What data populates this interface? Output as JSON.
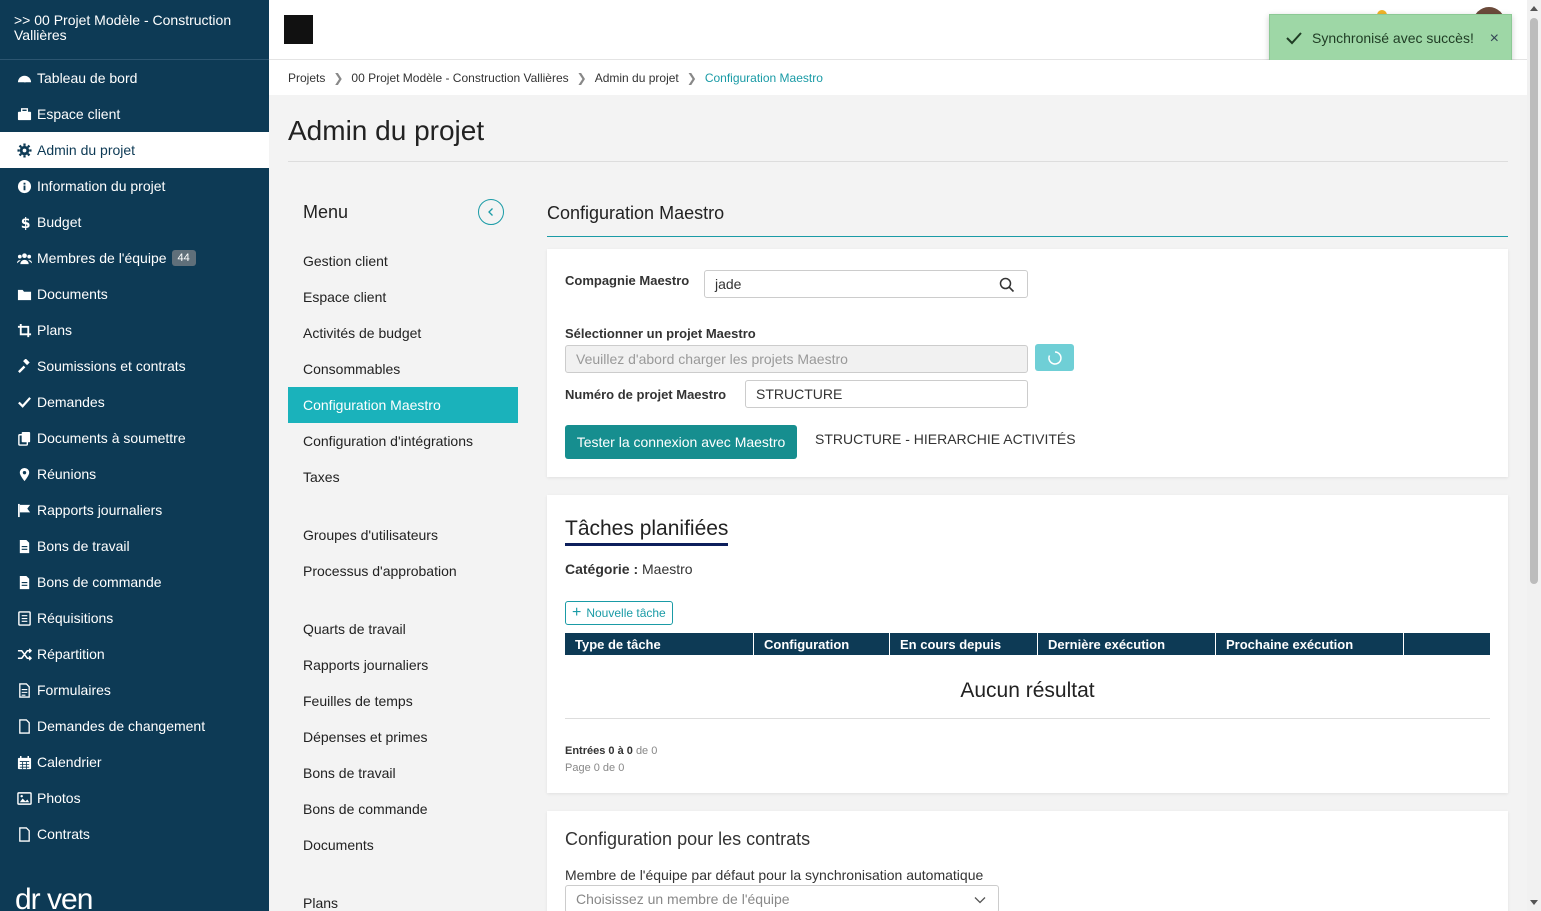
{
  "sidebar": {
    "project": ">> 00 Projet Modèle - Construction Vallières",
    "items": [
      {
        "label": "Tableau de bord",
        "icon": "dashboard-icon"
      },
      {
        "label": "Espace client",
        "icon": "briefcase-icon"
      },
      {
        "label": "Admin du projet",
        "icon": "gear-icon",
        "active": true
      },
      {
        "label": "Information du projet",
        "icon": "info-icon"
      },
      {
        "label": "Budget",
        "icon": "dollar-icon"
      },
      {
        "label": "Membres de l'équipe",
        "icon": "users-icon",
        "badge": "44"
      },
      {
        "label": "Documents",
        "icon": "folder-icon"
      },
      {
        "label": "Plans",
        "icon": "crop-icon"
      },
      {
        "label": "Soumissions et contrats",
        "icon": "gavel-icon"
      },
      {
        "label": "Demandes",
        "icon": "check-icon"
      },
      {
        "label": "Documents à soumettre",
        "icon": "copy-icon"
      },
      {
        "label": "Réunions",
        "icon": "map-pin-icon"
      },
      {
        "label": "Rapports journaliers",
        "icon": "flag-icon"
      },
      {
        "label": "Bons de travail",
        "icon": "file-icon"
      },
      {
        "label": "Bons de commande",
        "icon": "file-icon"
      },
      {
        "label": "Réquisitions",
        "icon": "list-icon"
      },
      {
        "label": "Répartition",
        "icon": "shuffle-icon"
      },
      {
        "label": "Formulaires",
        "icon": "form-icon"
      },
      {
        "label": "Demandes de changement",
        "icon": "file-outline-icon"
      },
      {
        "label": "Calendrier",
        "icon": "calendar-icon"
      },
      {
        "label": "Photos",
        "icon": "image-icon"
      },
      {
        "label": "Contrats",
        "icon": "file-outline-icon"
      }
    ],
    "logo": "dr ven"
  },
  "toast": {
    "message": "Synchronisé avec succès!",
    "close": "×"
  },
  "breadcrumb": [
    "Projets",
    "00 Projet Modèle - Construction Vallières",
    "Admin du projet",
    "Configuration Maestro"
  ],
  "page_title": "Admin du projet",
  "menu": {
    "title": "Menu",
    "groups": [
      [
        "Gestion client",
        "Espace client",
        "Activités de budget",
        "Consommables",
        "Configuration Maestro",
        "Configuration d'intégrations",
        "Taxes"
      ],
      [
        "Groupes d'utilisateurs",
        "Processus d'approbation"
      ],
      [
        "Quarts de travail",
        "Rapports journaliers",
        "Feuilles de temps",
        "Dépenses et primes",
        "Bons de travail",
        "Bons de commande",
        "Documents"
      ],
      [
        "Plans"
      ]
    ],
    "active": "Configuration Maestro"
  },
  "config": {
    "section_title": "Configuration Maestro",
    "company_label": "Compagnie Maestro",
    "company_value": "jade",
    "project_select_label": "Sélectionner un projet Maestro",
    "project_select_placeholder": "Veuillez d'abord charger les projets Maestro",
    "project_number_label": "Numéro de projet Maestro",
    "project_number_value": "STRUCTURE",
    "test_button": "Tester la connexion avec Maestro",
    "structure_text": "STRUCTURE - HIERARCHIE ACTIVITÉS"
  },
  "tasks": {
    "title": "Tâches planifiées",
    "category_label": "Catégorie :",
    "category_value": "Maestro",
    "new_task": "Nouvelle tâche",
    "columns": [
      "Type de tâche",
      "Configuration",
      "En cours depuis",
      "Dernière exécution",
      "Prochaine exécution",
      ""
    ],
    "empty": "Aucun résultat",
    "entries_bold": "Entrées 0 à 0",
    "entries_rest": "de 0",
    "page_info": "Page 0 de 0"
  },
  "contracts": {
    "title": "Configuration pour les contrats",
    "member_label": "Membre de l'équipe par défaut pour la synchronisation automatique",
    "member_placeholder": "Choisissez un membre de l'équipe"
  }
}
